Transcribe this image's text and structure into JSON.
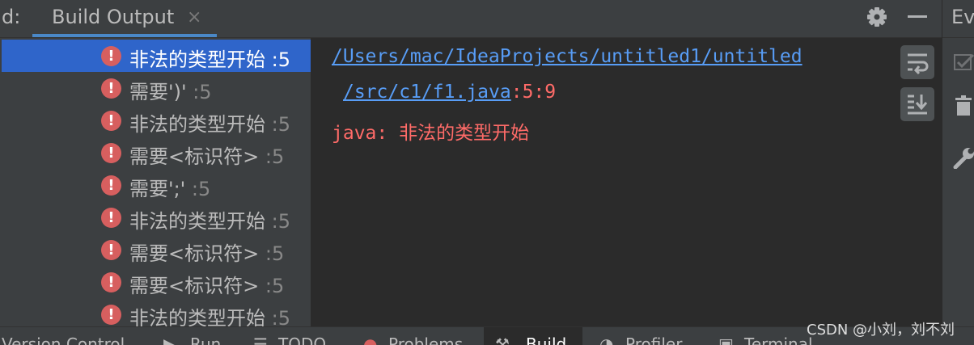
{
  "header": {
    "panel_prefix": "d:",
    "tab_label": "Build Output",
    "close_glyph": "×",
    "gear_icon": "gear-icon",
    "minimize_icon": "minimize-icon"
  },
  "tree": {
    "items": [
      {
        "message": "非法的类型开始",
        "line": ":5",
        "selected": true
      },
      {
        "message": "需要')'",
        "line": ":5",
        "selected": false
      },
      {
        "message": "非法的类型开始",
        "line": ":5",
        "selected": false
      },
      {
        "message": "需要<标识符>",
        "line": ":5",
        "selected": false
      },
      {
        "message": "需要';'",
        "line": ":5",
        "selected": false
      },
      {
        "message": "非法的类型开始",
        "line": ":5",
        "selected": false
      },
      {
        "message": "需要<标识符>",
        "line": ":5",
        "selected": false
      },
      {
        "message": "需要<标识符>",
        "line": ":5",
        "selected": false
      },
      {
        "message": "非法的类型开始",
        "line": ":5",
        "selected": false
      }
    ],
    "error_glyph": "!"
  },
  "console": {
    "path_line1": "/Users/mac/IdeaProjects/untitled1/untitled",
    "path_line2": "/src/c1/f1.java",
    "location": ":5:9",
    "error_message": "java: 非法的类型开始"
  },
  "console_toolbar": {
    "buttons": [
      "soft-wrap-icon",
      "scroll-to-end-icon"
    ]
  },
  "right_panel": {
    "title": "Ev",
    "icons": [
      "check-icon",
      "trash-icon",
      "wrench-icon"
    ]
  },
  "bottom_bar": {
    "items": [
      "Version Control",
      "Run",
      "TODO",
      "Problems",
      "Build",
      "Profiler",
      "Terminal"
    ],
    "active": "Build"
  },
  "watermark": "CSDN @小刘，刘不刘",
  "colors": {
    "accent": "#2f65ca",
    "error": "#d75f5f",
    "link": "#589df6",
    "console_error": "#ff6b68"
  }
}
